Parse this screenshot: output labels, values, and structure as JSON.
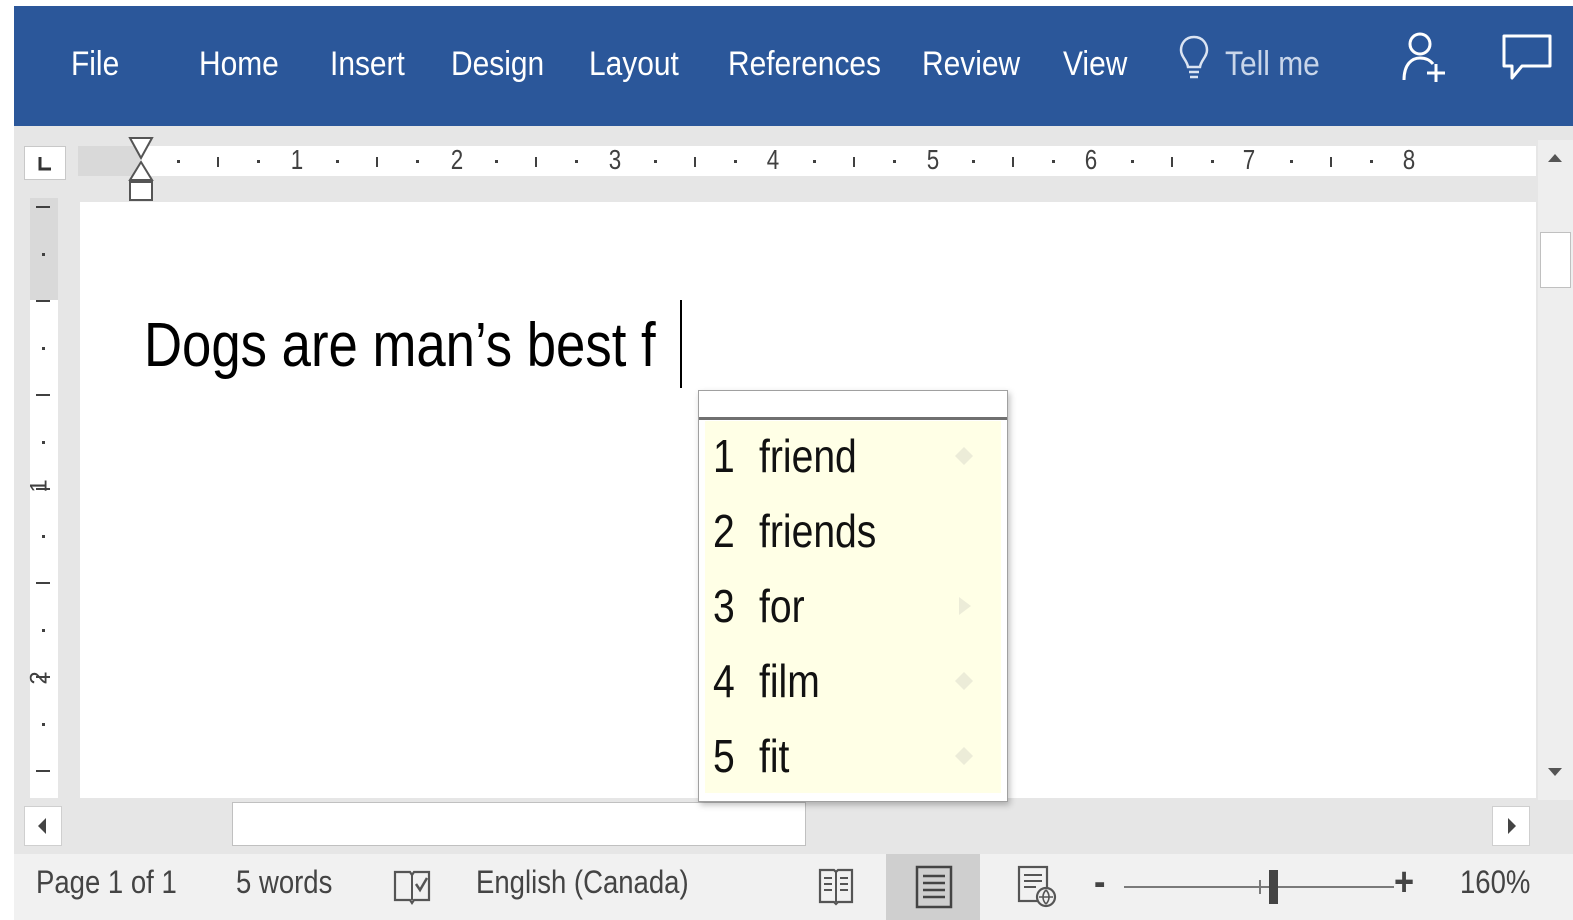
{
  "ribbon": {
    "tabs": [
      "File",
      "Home",
      "Insert",
      "Design",
      "Layout",
      "References",
      "Review",
      "View"
    ],
    "tell_me": "Tell me",
    "bg_color": "#2b579a",
    "icons": [
      "lightbulb-icon",
      "share-icon",
      "comment-icon"
    ]
  },
  "ruler": {
    "horizontal_numbers": [
      "1",
      "2",
      "3",
      "4",
      "5",
      "6",
      "7",
      "8"
    ],
    "vertical_numbers": [
      "1",
      "2"
    ]
  },
  "document": {
    "text": "Dogs are man’s best f"
  },
  "suggestions": {
    "items": [
      {
        "num": "1",
        "word": "friend"
      },
      {
        "num": "2",
        "word": "friends"
      },
      {
        "num": "3",
        "word": "for"
      },
      {
        "num": "4",
        "word": "film"
      },
      {
        "num": "5",
        "word": "fit"
      }
    ],
    "bg_color": "#ffffe6"
  },
  "status": {
    "page": "Page 1 of 1",
    "words": "5 words",
    "language": "English (Canada)",
    "zoom_minus": "-",
    "zoom_plus": "+",
    "zoom": "160%",
    "zoom_level": 0.55,
    "active_view": "print-layout"
  }
}
